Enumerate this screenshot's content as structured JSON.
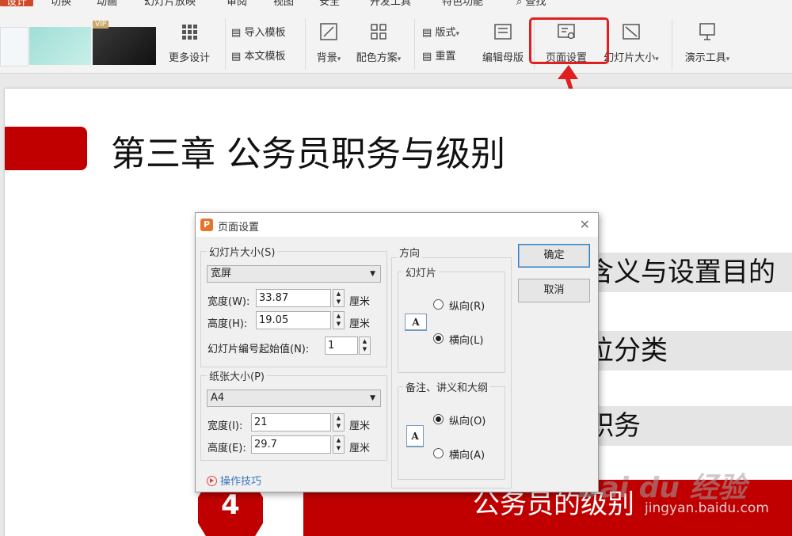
{
  "menu": {
    "tabs": [
      "设计",
      "切换",
      "动画",
      "幻灯片放映",
      "审阅",
      "视图",
      "安全",
      "开发工具",
      "特色功能",
      "查找"
    ]
  },
  "ribbon": {
    "vip_badge": "VIP",
    "more_design": "更多设计",
    "import_template": "导入模板",
    "text_template": "本文模板",
    "background": "背景",
    "color_scheme": "配色方案",
    "layout": "版式",
    "reset": "重置",
    "edit_master": "编辑母版",
    "page_setup": "页面设置",
    "slide_size": "幻灯片大小",
    "presentation_tools": "演示工具",
    "highlight_color": "#e02020"
  },
  "slide": {
    "title": "第三章 公务员职务与级别",
    "rows": [
      "含义与设置目的",
      "位分类",
      "职务"
    ],
    "badge_number": "4",
    "banner_text": "公务员的级别",
    "watermark": "Bai du 经验",
    "watermark_url": "jingyan.baidu.com",
    "accent_color": "#c00000"
  },
  "dialog": {
    "title": "页面设置",
    "slide_size_group": "幻灯片大小(S)",
    "slide_size_value": "宽屏",
    "width_label": "宽度(W):",
    "width_value": "33.87",
    "height_label": "高度(H):",
    "height_value": "19.05",
    "unit": "厘米",
    "start_number_label": "幻灯片编号起始值(N):",
    "start_number_value": "1",
    "paper_group": "纸张大小(P)",
    "paper_value": "A4",
    "paper_width_label": "宽度(I):",
    "paper_width_value": "21",
    "paper_height_label": "高度(E):",
    "paper_height_value": "29.7",
    "orientation_group": "方向",
    "slides_subgroup": "幻灯片",
    "portrait_r": "纵向(R)",
    "landscape_l": "横向(L)",
    "notes_subgroup": "备注、讲义和大纲",
    "portrait_o": "纵向(O)",
    "landscape_a": "横向(A)",
    "ok": "确定",
    "cancel": "取消",
    "tips": "操作技巧",
    "page_icon_letter": "A"
  }
}
